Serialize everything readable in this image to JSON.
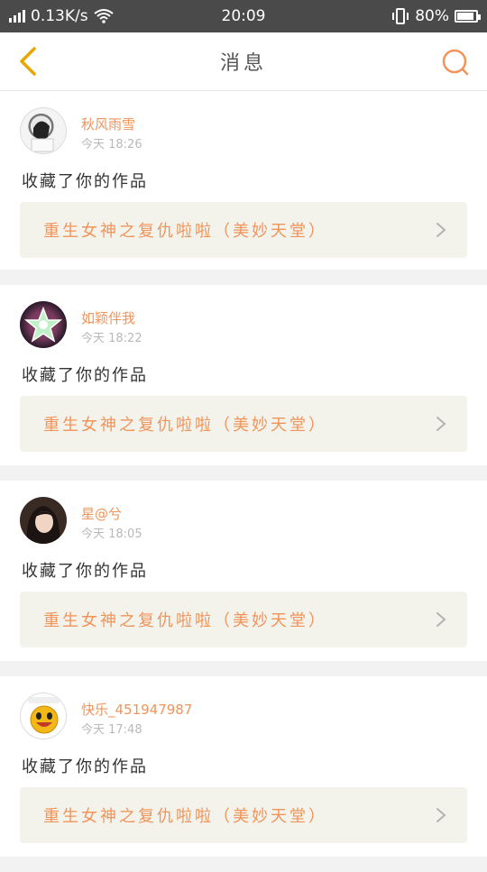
{
  "status_bar": {
    "network_speed": "0.13K/s",
    "time": "20:09",
    "battery_percent": "80%",
    "battery_level": 0.8,
    "icons": [
      "signal-icon",
      "wifi-icon",
      "vibrate-icon",
      "battery-icon"
    ]
  },
  "header": {
    "title": "消息",
    "back_icon": "chevron-left-icon",
    "search_icon": "search-icon",
    "accent_color": "#f0945a"
  },
  "messages": [
    {
      "username": "秋风雨雪",
      "time": "今天 18:26",
      "action": "收藏了你的作品",
      "work_title": "重生女神之复仇啦啦（美妙天堂）"
    },
    {
      "username": "如颖伴我",
      "time": "今天 18:22",
      "action": "收藏了你的作品",
      "work_title": "重生女神之复仇啦啦（美妙天堂）"
    },
    {
      "username": "星@兮",
      "time": "今天 18:05",
      "action": "收藏了你的作品",
      "work_title": "重生女神之复仇啦啦（美妙天堂）"
    },
    {
      "username": "快乐_451947987",
      "time": "今天 17:48",
      "action": "收藏了你的作品",
      "work_title": "重生女神之复仇啦啦（美妙天堂）"
    }
  ]
}
